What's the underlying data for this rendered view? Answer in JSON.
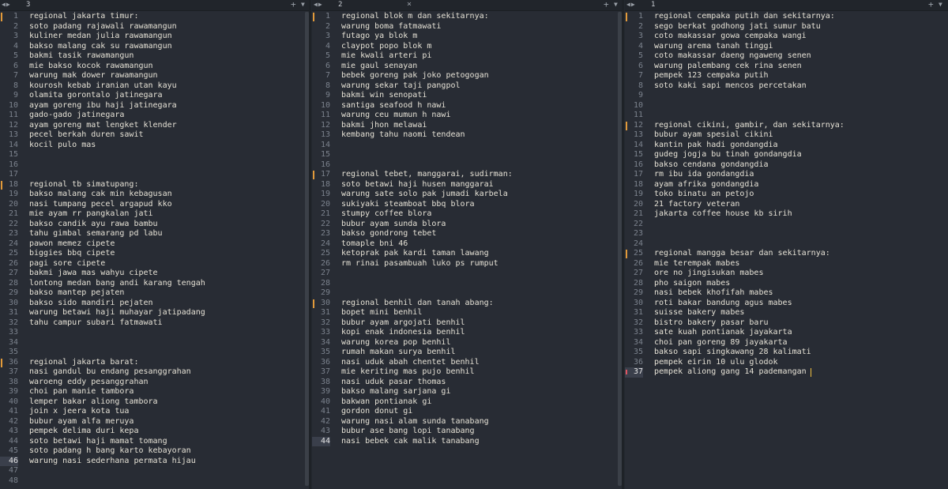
{
  "panes": [
    {
      "tab": {
        "number": "3"
      },
      "lines": [
        "regional jakarta timur:",
        "soto padang rajawali rawamangun",
        "kuliner medan julia rawamangun",
        "bakso malang cak su rawamangun",
        "bakmi tasik rawamangun",
        "mie bakso kocok rawamangun",
        "warung mak dower rawamangun",
        "kourosh kebab iranian utan kayu",
        "olamita gorontalo jatinegara",
        "ayam goreng ibu haji jatinegara",
        "gado-gado jatinegara",
        "ayam goreng mat lengket klender",
        "pecel berkah duren sawit",
        "kocil pulo mas",
        "",
        "",
        "",
        "regional tb simatupang:",
        "bakso malang cak min kebagusan",
        "nasi tumpang pecel argapud kko",
        "mie ayam rr pangkalan jati",
        "bakso candik ayu rawa bambu",
        "tahu gimbal semarang pd labu",
        "pawon memez cipete",
        "biggies bbq cipete",
        "pagi sore cipete",
        "bakmi jawa mas wahyu cipete",
        "lontong medan bang andi karang tengah",
        "bakso mantep pejaten",
        "bakso sido mandiri pejaten",
        "warung betawi haji muhayar jatipadang",
        "tahu campur subari fatmawati",
        "",
        "",
        "",
        "regional jakarta barat:",
        "nasi gandul bu endang pesanggrahan",
        "waroeng eddy pesanggrahan",
        "choi pan manie tambora",
        "lemper bakar aliong tambora",
        "join x jeera kota tua",
        "bubur ayam alfa meruya",
        "pempek delima duri kepa",
        "soto betawi haji mamat tomang",
        "soto padang h bang karto kebayoran",
        "warung nasi sederhana permata hijau",
        "",
        ""
      ],
      "current_line": "46"
    },
    {
      "tab": {
        "number": "2",
        "close": "×"
      },
      "lines": [
        "regional blok m dan sekitarnya:",
        "warung boma fatmawati",
        "futago ya blok m",
        "claypot popo blok m",
        "mie kwali arteri pi",
        "mie gaul senayan",
        "bebek goreng pak joko petogogan",
        "warung sekar taji pangpol",
        "bakmi win senopati",
        "santiga seafood h nawi",
        "warung ceu mumun h nawi",
        "bakmi jhon melawai",
        "kembang tahu naomi tendean",
        "",
        "",
        "",
        "regional tebet, manggarai, sudirman:",
        "soto betawi haji husen manggarai",
        "warung sate solo pak jumadi karbela",
        "sukiyaki steamboat bbq blora",
        "stumpy coffee blora",
        "bubur ayam sunda blora",
        "bakso gondrong tebet",
        "tomaple bni 46",
        "ketoprak pak kardi taman lawang",
        "rm rinai pasambuah luko ps rumput",
        "",
        "",
        "",
        "regional benhil dan tanah abang:",
        "bopet mini benhil",
        "bubur ayam argojati benhil",
        "kopi enak indonesia benhil",
        "warung korea pop benhil",
        "rumah makan surya benhil",
        "nasi uduk abah chentet benhil",
        "mie keriting mas pujo benhil",
        "nasi uduk pasar thomas",
        "bakso malang sarjana gi",
        "bakwan pontianak gi",
        "gordon donut gi",
        "warung nasi alam sunda tanabang",
        "bubur ase bang lopi tanabang",
        "nasi bebek cak malik tanabang"
      ],
      "current_line": "44"
    },
    {
      "tab": {
        "number": "1"
      },
      "lines": [
        "regional cempaka putih dan sekitarnya:",
        "sego berkat godhong jati sumur batu",
        "coto makassar gowa cempaka wangi",
        "warung arema tanah tinggi",
        "coto makassar daeng ngaweng senen",
        "warung palembang cek rina senen",
        "pempek 123 cempaka putih",
        "soto kaki sapi mencos percetakan",
        "",
        "",
        "",
        "regional cikini, gambir, dan sekitarnya:",
        "bubur ayam spesial cikini",
        "kantin pak hadi gondangdia",
        "gudeg jogja bu tinah gondangdia",
        "bakso cendana gondangdia",
        "rm ibu ida gondangdia",
        "ayam afrika gondangdia",
        "toko binatu an petojo",
        "21 factory veteran",
        "jakarta coffee house kb sirih",
        "",
        "",
        "",
        "regional mangga besar dan sekitarnya:",
        "mie terempak mabes",
        "ore no jingisukan mabes",
        "pho saigon mabes",
        "nasi bebek khofifah mabes",
        "roti bakar bandung agus mabes",
        "suisse bakery mabes",
        "bistro bakery pasar baru",
        "sate kuah pontianak jayakarta",
        "choi pan goreng 89 jayakarta",
        "bakso sapi singkawang 28 kalimati",
        "pempek eirin 10 ulu glodok",
        "pempek aliong gang 14 pademangan"
      ],
      "current_line": "37"
    }
  ],
  "icons": {
    "nav": "left-right-arrows-icon",
    "add": "plus-icon",
    "menu": "dropdown-arrow-icon"
  },
  "colors": {
    "background": "#282c34",
    "text": "#e6e2d6",
    "line_number": "#7b828d",
    "modified_marker": "#e29a3a",
    "caret": "#f0c040"
  }
}
